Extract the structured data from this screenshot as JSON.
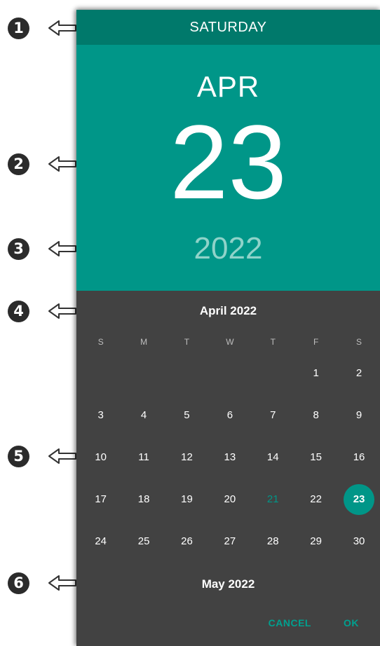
{
  "annotations": [
    "1",
    "2",
    "3",
    "4",
    "5",
    "6"
  ],
  "header": {
    "day_of_week": "SATURDAY",
    "month": "APR",
    "day": "23",
    "year": "2022"
  },
  "calendar": {
    "month_title": "April 2022",
    "weekdays": [
      "S",
      "M",
      "T",
      "W",
      "T",
      "F",
      "S"
    ],
    "weeks": [
      [
        "",
        "",
        "",
        "",
        "",
        "1",
        "2"
      ],
      [
        "3",
        "4",
        "5",
        "6",
        "7",
        "8",
        "9"
      ],
      [
        "10",
        "11",
        "12",
        "13",
        "14",
        "15",
        "16"
      ],
      [
        "17",
        "18",
        "19",
        "20",
        "21",
        "22",
        "23"
      ],
      [
        "24",
        "25",
        "26",
        "27",
        "28",
        "29",
        "30"
      ]
    ],
    "today": "21",
    "selected": "23",
    "next_month_title": "May 2022"
  },
  "actions": {
    "cancel_label": "CANCEL",
    "ok_label": "OK"
  },
  "colors": {
    "accent": "#009688",
    "accent_dark": "#00796b",
    "calendar_bg": "#424242"
  }
}
